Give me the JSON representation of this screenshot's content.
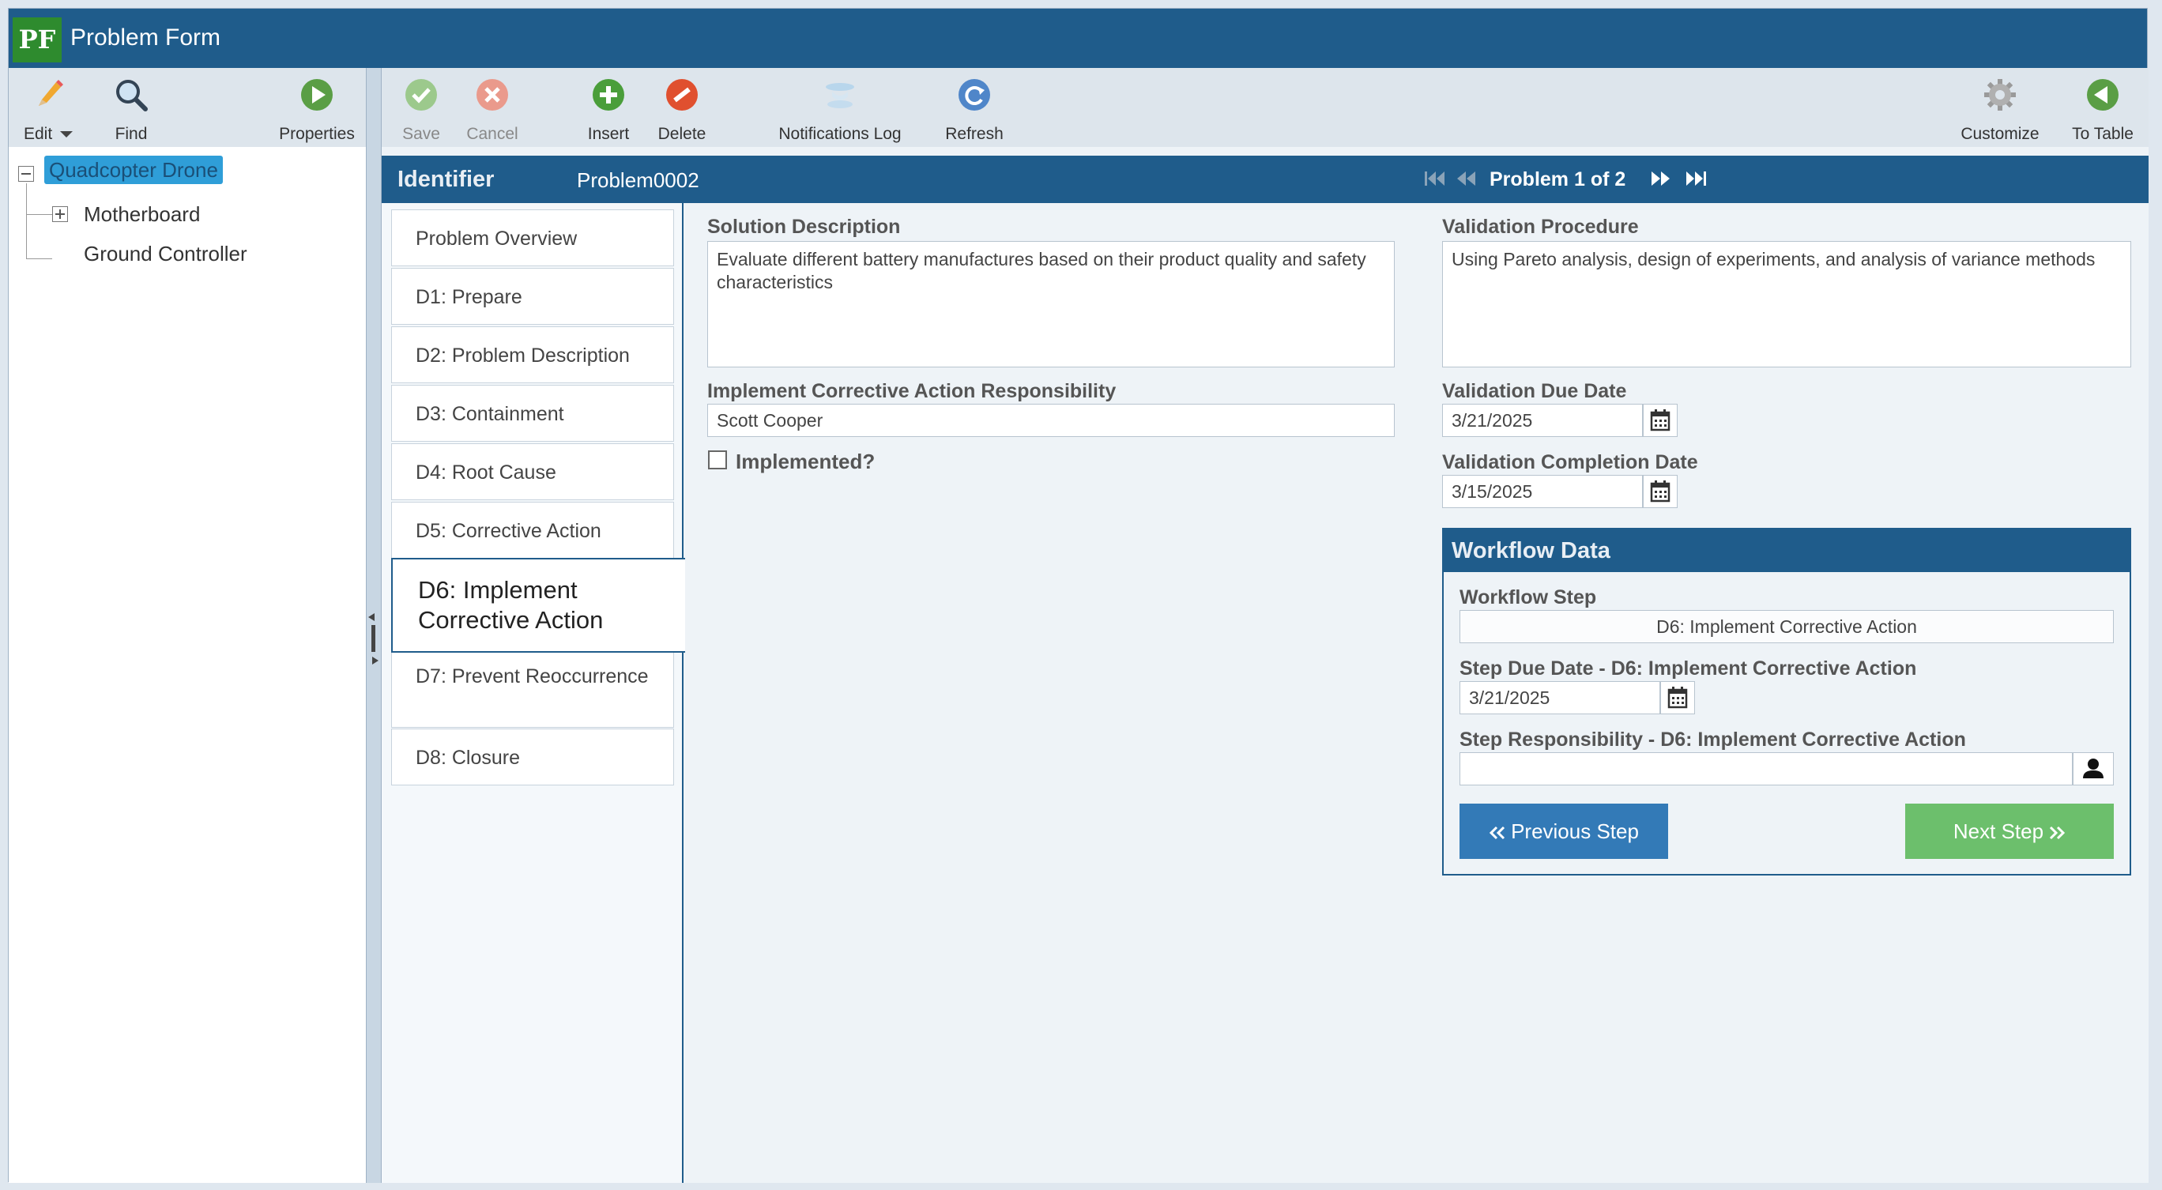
{
  "app": {
    "logo_text": "PF",
    "title": "Problem Form"
  },
  "left_toolbar": {
    "edit": "Edit",
    "find": "Find",
    "properties": "Properties"
  },
  "tree": {
    "root": "Quadcopter Drone",
    "children": [
      "Motherboard",
      "Ground Controller"
    ]
  },
  "main_toolbar": {
    "save": "Save",
    "cancel": "Cancel",
    "insert": "Insert",
    "delete": "Delete",
    "notifications_log": "Notifications Log",
    "refresh": "Refresh",
    "customize": "Customize",
    "to_table": "To Table"
  },
  "record": {
    "identifier_label": "Identifier",
    "identifier_value": "Problem0002",
    "nav_text": "Problem 1 of 2"
  },
  "tabs": [
    "Problem Overview",
    "D1: Prepare",
    "D2: Problem Description",
    "D3: Containment",
    "D4: Root Cause",
    "D5: Corrective Action",
    "D6: Implement Corrective Action",
    "D7: Prevent Reoccurrence",
    "D8: Closure"
  ],
  "form": {
    "solution_description_label": "Solution Description",
    "solution_description": "Evaluate different battery manufactures based on their product quality and safety characteristics",
    "responsibility_label": "Implement Corrective Action Responsibility",
    "responsibility": "Scott Cooper",
    "implemented_label": "Implemented?",
    "validation_procedure_label": "Validation Procedure",
    "validation_procedure": "Using Pareto analysis, design of experiments, and analysis of variance methods",
    "validation_due_date_label": "Validation Due Date",
    "validation_due_date": "3/21/2025",
    "validation_completion_date_label": "Validation Completion Date",
    "validation_completion_date": "3/15/2025"
  },
  "workflow": {
    "header": "Workflow Data",
    "step_label": "Workflow Step",
    "step_value": "D6: Implement Corrective Action",
    "step_due_label": "Step Due Date - D6: Implement Corrective Action",
    "step_due_value": "3/21/2025",
    "step_resp_label": "Step Responsibility - D6: Implement Corrective Action",
    "step_resp_value": "",
    "previous_button": "Previous Step",
    "next_button": "Next Step"
  },
  "colors": {
    "header_blue": "#1f5c8b",
    "selected_tree": "#2f9ed8",
    "previous_button": "#337ab7",
    "next_button": "#6cbf6c"
  }
}
